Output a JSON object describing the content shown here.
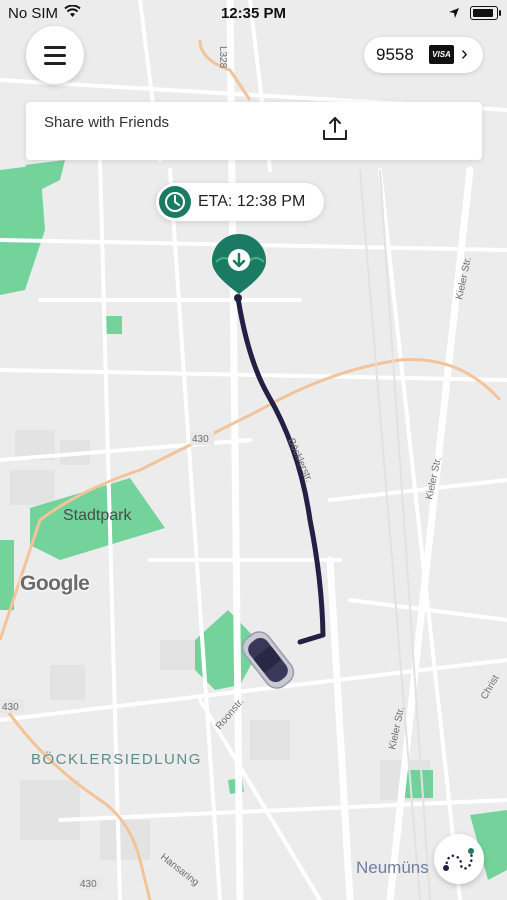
{
  "status_bar": {
    "carrier": "No SIM",
    "time": "12:35 PM"
  },
  "payment": {
    "card_last4": "9558",
    "card_brand": "VISA"
  },
  "share": {
    "label": "Share with Friends"
  },
  "eta": {
    "label": "ETA: 12:38 PM"
  },
  "map": {
    "labels": {
      "stadtpark": "Stadtpark",
      "bockler": "BÖCKLERSIEDLUNG",
      "neumuns": "Neumüns",
      "google": "Google",
      "road_430_a": "430",
      "road_430_b": "430",
      "road_430_c": "430",
      "road_l328": "L328",
      "kieler_str_1": "Kieler Str.",
      "kieler_str_2": "Kieler Str.",
      "kieler_str_3": "Kieler Str.",
      "roonstr": "Roonstr.",
      "bocklerstr": "Böcklerstr.",
      "hansaring": "Hansaring",
      "christ": "Christ"
    }
  },
  "colors": {
    "accent": "#1a7a63",
    "route": "#232045",
    "park": "#5fcf8e",
    "main_road": "#f3c39a"
  },
  "icons": {
    "menu": "hamburger-icon",
    "share": "share-upload-icon",
    "clock": "clock-icon",
    "pin": "destination-pin-icon",
    "car": "car-icon",
    "route": "route-overview-icon"
  }
}
